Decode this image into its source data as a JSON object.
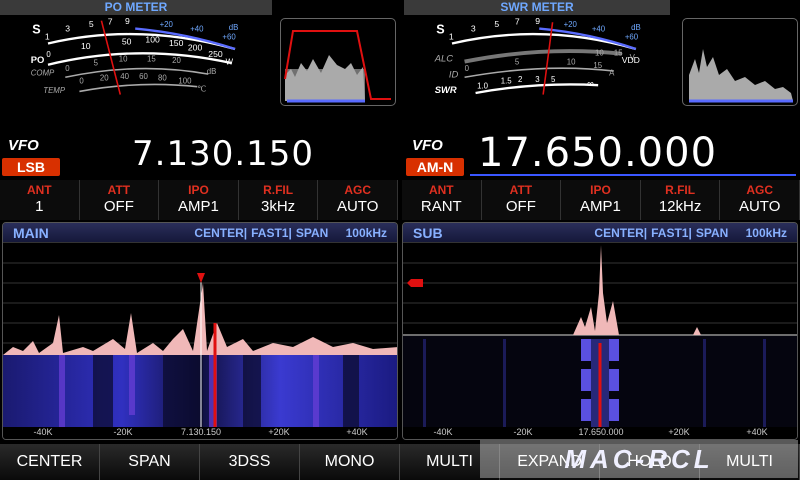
{
  "main_meter": {
    "title": "PO METER",
    "s_label": "S",
    "s_scale": [
      "1",
      "3",
      "5",
      "7",
      "9",
      "+20",
      "+40",
      "+60"
    ],
    "s_unit": "dB",
    "po_label": "PO",
    "po_scale": [
      "0",
      "10",
      "50",
      "100",
      "150",
      "200",
      "250"
    ],
    "po_unit": "W",
    "comp_label": "COMP",
    "comp_scale": [
      "0",
      "5",
      "10",
      "15",
      "20"
    ],
    "comp_unit": "dB",
    "temp_label": "TEMP",
    "temp_scale": [
      "0",
      "20",
      "40",
      "60",
      "80",
      "100"
    ],
    "temp_unit": "℃"
  },
  "sub_meter": {
    "title": "SWR METER",
    "s_label": "S",
    "s_scale": [
      "1",
      "3",
      "5",
      "7",
      "9",
      "+20",
      "+40",
      "+60"
    ],
    "s_unit": "dB",
    "alc_label": "ALC",
    "vdd_scale": [
      "10",
      "15"
    ],
    "vdd_unit": "V",
    "vdd_label": "VDD",
    "id_label": "ID",
    "id_scale": [
      "0",
      "5",
      "10",
      "15"
    ],
    "id_unit": "A",
    "swr_label": "SWR",
    "swr_scale": [
      "1.0",
      "1.5",
      "2",
      "3",
      "5",
      "∞"
    ]
  },
  "main_vfo": {
    "label": "VFO",
    "mode": "LSB",
    "frequency": "7.130.150"
  },
  "sub_vfo": {
    "label": "VFO",
    "mode": "AM-N",
    "frequency": "17.650.000"
  },
  "main_params": [
    {
      "k": "ANT",
      "v": "1"
    },
    {
      "k": "ATT",
      "v": "OFF"
    },
    {
      "k": "IPO",
      "v": "AMP1"
    },
    {
      "k": "R.FIL",
      "v": "3kHz"
    },
    {
      "k": "AGC",
      "v": "AUTO"
    }
  ],
  "sub_params": [
    {
      "k": "ANT",
      "v": "RANT"
    },
    {
      "k": "ATT",
      "v": "OFF"
    },
    {
      "k": "IPO",
      "v": "AMP1"
    },
    {
      "k": "R.FIL",
      "v": "12kHz"
    },
    {
      "k": "AGC",
      "v": "AUTO"
    }
  ],
  "main_scope": {
    "name": "MAIN",
    "mode": "CENTER",
    "speed": "FAST1",
    "span_label": "SPAN",
    "span": "100kHz",
    "x_labels": [
      "-40K",
      "-20K",
      "7.130.150",
      "+20K",
      "+40K"
    ]
  },
  "sub_scope": {
    "name": "SUB",
    "mode": "CENTER",
    "speed": "FAST1",
    "span_label": "SPAN",
    "span": "100kHz",
    "x_labels": [
      "-40K",
      "-20K",
      "17.650.000",
      "+20K",
      "+40K"
    ]
  },
  "softkeys": [
    "CENTER",
    "SPAN",
    "3DSS",
    "MONO",
    "MULTI",
    "EXPAND",
    "HOLD",
    "MULTI"
  ],
  "watermark": "MAC-RCL",
  "colors": {
    "mode_badge": "#d83000",
    "param_key": "#e03020",
    "scope_title": "#88b0ff",
    "meter_title": "#6fa8ff"
  }
}
